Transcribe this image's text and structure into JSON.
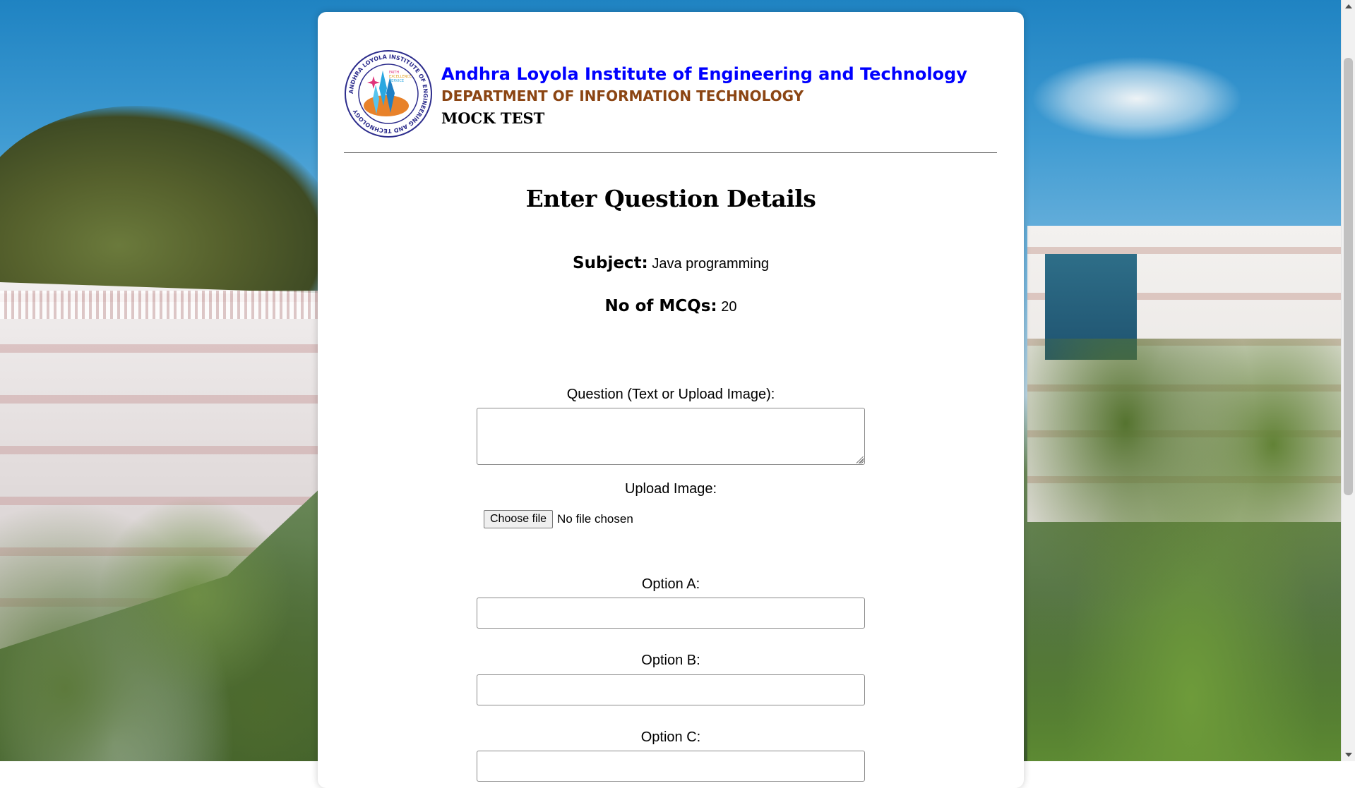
{
  "header": {
    "institute_name": "Andhra Loyola Institute of Engineering and Technology",
    "department": "DEPARTMENT OF INFORMATION TECHNOLOGY",
    "subtitle": "MOCK TEST",
    "logo": {
      "ring_text": "ANDHRA LOYOLA INSTITUTE OF ENGINEERING AND TECHNOLOGY",
      "motto": [
        "FAITH",
        "EXCELLENCE",
        "SERVICE"
      ]
    }
  },
  "form": {
    "title": "Enter Question Details",
    "subject_label": "Subject:",
    "subject_value": "Java programming",
    "mcq_label": "No of MCQs:",
    "mcq_value": "20",
    "question_label": "Question (Text or Upload Image):",
    "question_value": "",
    "upload_label": "Upload Image:",
    "choose_file_label": "Choose file",
    "file_status": "No file chosen",
    "option_a_label": "Option A:",
    "option_a_value": "",
    "option_b_label": "Option B:",
    "option_b_value": "",
    "option_c_label": "Option C:",
    "option_c_value": ""
  },
  "colors": {
    "institute_name": "#0000ff",
    "department": "#8b4513",
    "card_background": "#ffffff"
  }
}
